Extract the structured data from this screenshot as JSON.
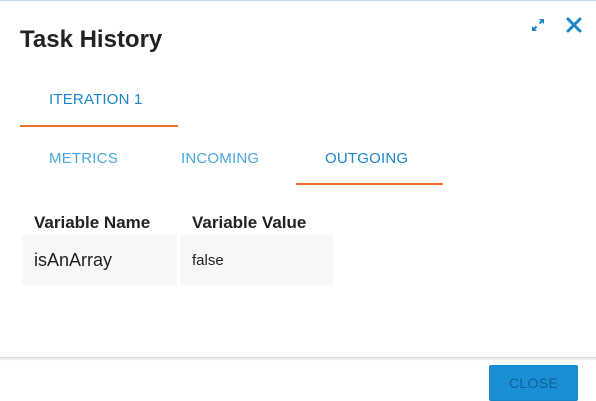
{
  "dialog": {
    "title": "Task History",
    "expand_icon": "expand-arrows-icon",
    "close_icon": "close-x-icon",
    "accent_color": "#1a86c9",
    "tab_underline_color": "#f07028"
  },
  "iteration_tabs": [
    {
      "label": "ITERATION 1",
      "active": true
    }
  ],
  "detail_tabs": [
    {
      "label": "METRICS",
      "active": false
    },
    {
      "label": "INCOMING",
      "active": false
    },
    {
      "label": "OUTGOING",
      "active": true
    }
  ],
  "variables": {
    "columns": [
      "Variable Name",
      "Variable Value"
    ],
    "rows": [
      {
        "name": "isAnArray",
        "value": "false"
      }
    ]
  },
  "footer": {
    "close_label": "CLOSE"
  }
}
